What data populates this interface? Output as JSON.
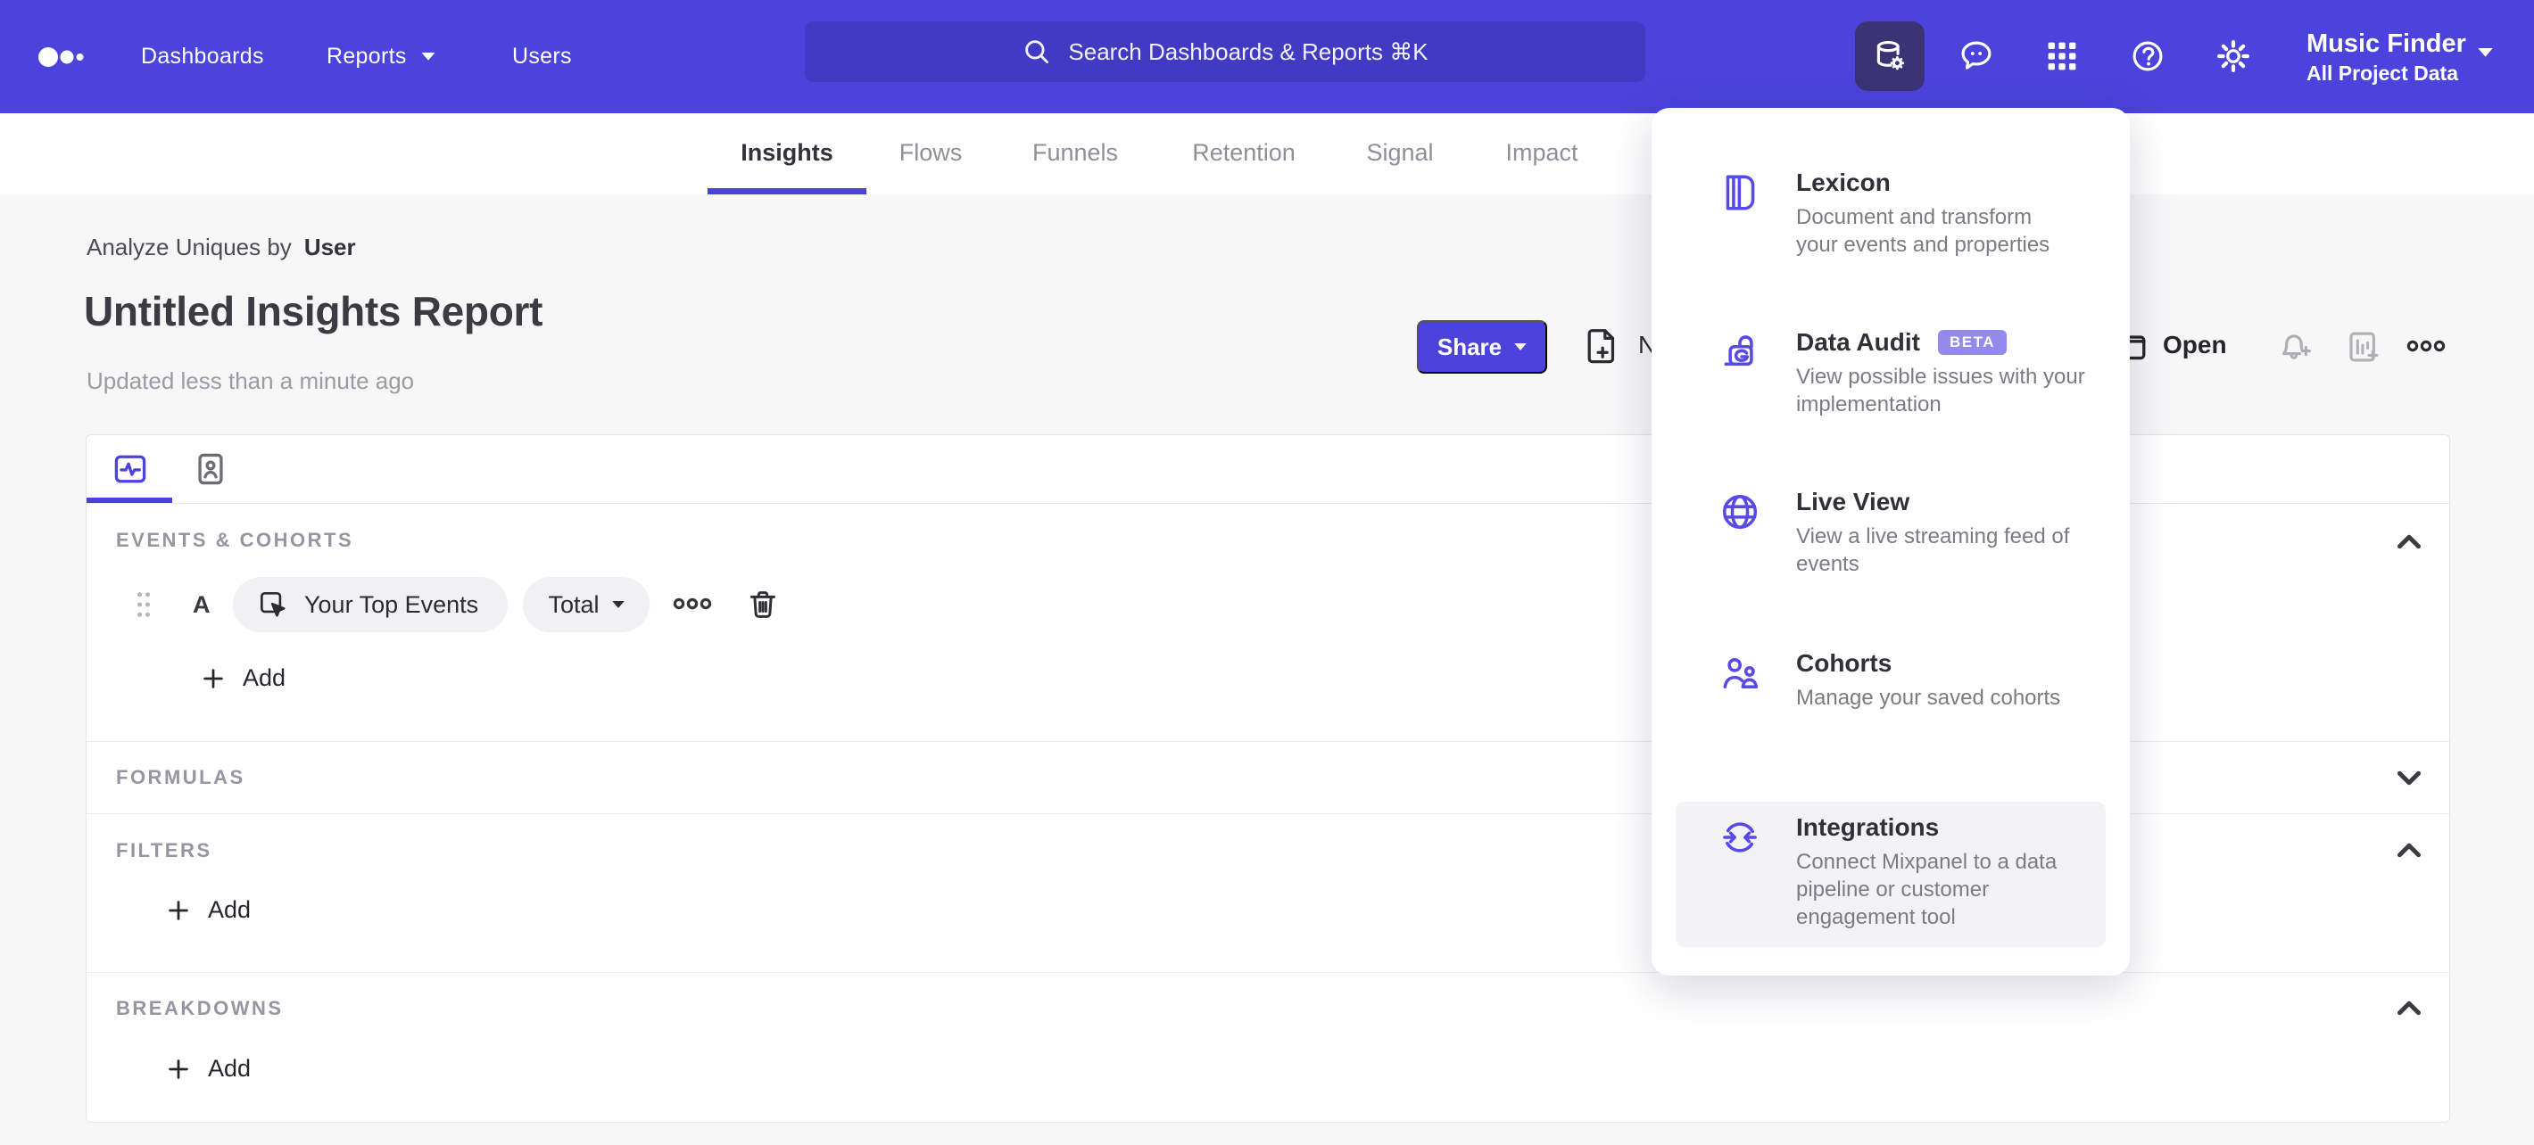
{
  "nav": {
    "items": [
      {
        "label": "Dashboards"
      },
      {
        "label": "Reports"
      },
      {
        "label": "Users"
      }
    ],
    "search_placeholder": "Search Dashboards & Reports ⌘K",
    "project_name": "Music Finder",
    "project_scope": "All Project Data"
  },
  "tabs": [
    {
      "label": "Insights"
    },
    {
      "label": "Flows"
    },
    {
      "label": "Funnels"
    },
    {
      "label": "Retention"
    },
    {
      "label": "Signal"
    },
    {
      "label": "Impact"
    }
  ],
  "report": {
    "analyze_prefix": "Analyze Uniques by",
    "analyze_entity": "User",
    "title": "Untitled Insights Report",
    "updated": "Updated less than a minute ago",
    "share": "Share",
    "new": "New",
    "open": "Open"
  },
  "builder": {
    "events_label": "EVENTS & COHORTS",
    "formulas_label": "FORMULAS",
    "filters_label": "FILTERS",
    "breakdowns_label": "BREAKDOWNS",
    "row_letter": "A",
    "row_event": "Your Top Events",
    "row_metric": "Total",
    "add": "Add"
  },
  "menu": {
    "items": [
      {
        "title": "Lexicon",
        "desc": "Document and transform\nyour events and properties"
      },
      {
        "title": "Data Audit",
        "badge": "BETA",
        "desc": "View possible issues with your\nimplementation"
      },
      {
        "title": "Live View",
        "desc": "View a live streaming feed of\nevents"
      },
      {
        "title": "Cohorts",
        "desc": "Manage your saved cohorts"
      },
      {
        "title": "Integrations",
        "desc": "Connect Mixpanel to a data\npipeline or customer\nengagement tool"
      }
    ]
  },
  "colors": {
    "accent": "#4b43db",
    "menu_icon": "#584ae6",
    "beta_badge": "#9489ec",
    "active_tool_bg": "#3a3474",
    "page_bg": "#f7f7f8"
  }
}
